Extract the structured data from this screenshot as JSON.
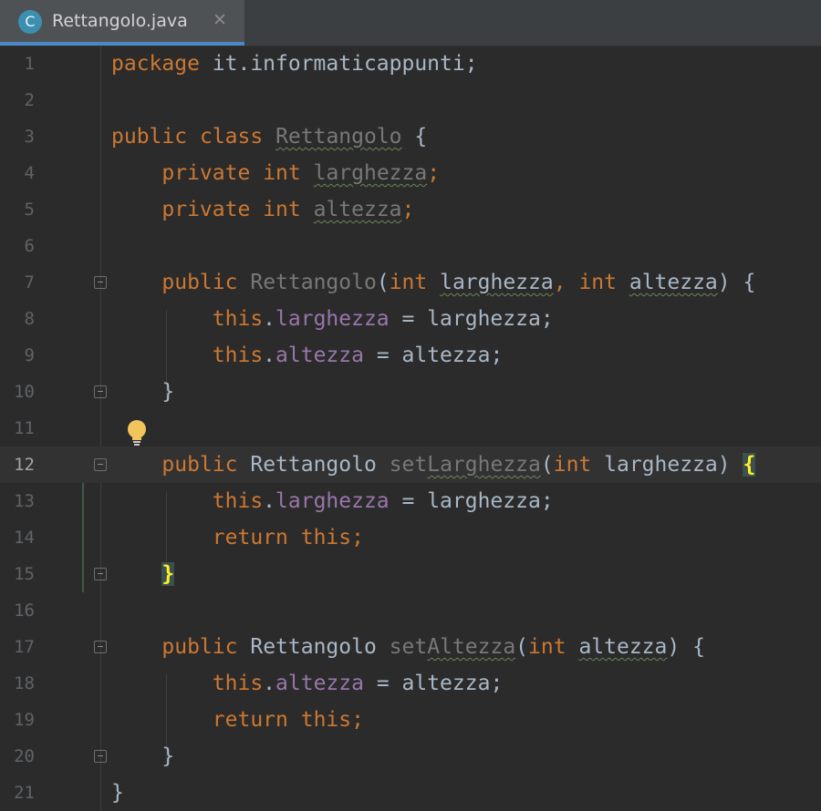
{
  "tab": {
    "icon_letter": "C",
    "title": "Rettangolo.java",
    "close_glyph": "✕"
  },
  "line_numbers": [
    "1",
    "2",
    "3",
    "4",
    "5",
    "6",
    "7",
    "8",
    "9",
    "10",
    "11",
    "12",
    "13",
    "14",
    "15",
    "16",
    "17",
    "18",
    "19",
    "20",
    "21"
  ],
  "current_line": "12",
  "code": {
    "l1_kw": "package",
    "l1_rest": " it.informaticappunti;",
    "l3_kw1": "public",
    "l3_kw2": "class",
    "l3_name": "Rettangolo",
    "l3_rest": " {",
    "l4_kw1": "private",
    "l4_kw2": "int",
    "l4_name": "larghezza",
    "l4_semi": ";",
    "l5_kw1": "private",
    "l5_kw2": "int",
    "l5_name": "altezza",
    "l5_semi": ";",
    "l7_kw": "public",
    "l7_name": "Rettangolo",
    "l7_p1": "(",
    "l7_t1": "int",
    "l7_a1": "larghezza",
    "l7_c": ",",
    "l7_t2": "int",
    "l7_a2": "altezza",
    "l7_end": ") {",
    "l8_this": "this",
    "l8_dot": ".",
    "l8_field": "larghezza",
    "l8_rest": " = larghezza;",
    "l9_this": "this",
    "l9_dot": ".",
    "l9_field": "altezza",
    "l9_rest": " = altezza;",
    "l10_brace": "}",
    "l12_kw": "public",
    "l12_type": "Rettangolo",
    "l12_m1": "set",
    "l12_m2": "Larghezza",
    "l12_p1": "(",
    "l12_t": "int",
    "l12_a": "larghezza",
    "l12_close": ") ",
    "l12_brace": "{",
    "l13_this": "this",
    "l13_dot": ".",
    "l13_field": "larghezza",
    "l13_rest": " = larghezza;",
    "l14_kw1": "return",
    "l14_kw2": "this",
    "l14_semi": ";",
    "l15_brace": "}",
    "l17_kw": "public",
    "l17_type": "Rettangolo",
    "l17_m1": "set",
    "l17_m2": "Altezza",
    "l17_p1": "(",
    "l17_t": "int",
    "l17_a": "altezza",
    "l17_end": ") {",
    "l18_this": "this",
    "l18_dot": ".",
    "l18_field": "altezza",
    "l18_rest": " = altezza;",
    "l19_kw1": "return",
    "l19_kw2": "this",
    "l19_semi": ";",
    "l20_brace": "}",
    "l21_brace": "}"
  },
  "icons": {
    "bulb": "lightbulb-icon",
    "fold": "fold-marker-icon",
    "close": "close-icon",
    "class": "java-class-icon"
  },
  "colors": {
    "background": "#2b2b2b",
    "keyword": "#cc7832",
    "field": "#9876aa",
    "text": "#a9b7c6",
    "tab_accent": "#4a88c7",
    "bulb": "#f2c55c"
  }
}
